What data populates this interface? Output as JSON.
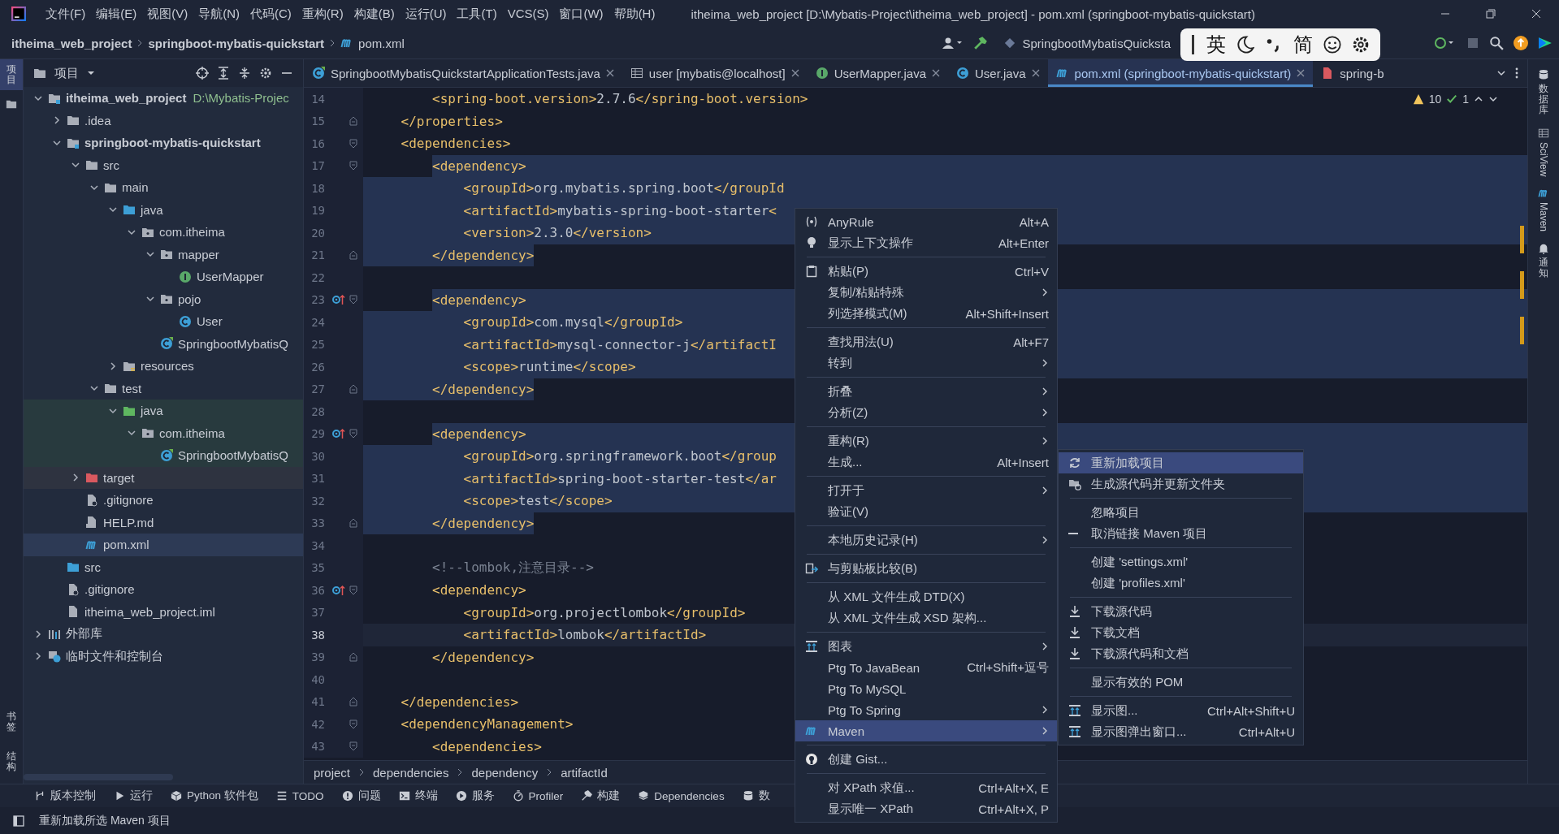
{
  "menu_bar": [
    "文件(F)",
    "编辑(E)",
    "视图(V)",
    "导航(N)",
    "代码(C)",
    "重构(R)",
    "构建(B)",
    "运行(U)",
    "工具(T)",
    "VCS(S)",
    "窗口(W)",
    "帮助(H)"
  ],
  "window": {
    "title": "itheima_web_project [D:\\Mybatis-Project\\itheima_web_project] - pom.xml (springboot-mybatis-quickstart)"
  },
  "nav_bar": {
    "breadcrumb": [
      {
        "label": "itheima_web_project",
        "kind": "project"
      },
      {
        "label": "springboot-mybatis-quickstart",
        "kind": "module"
      },
      {
        "label": "pom.xml",
        "kind": "maven-file"
      }
    ],
    "run_config": "SpringbootMybatisQuicksta"
  },
  "ime_toolbar": {
    "items": [
      {
        "kind": "cursor"
      },
      {
        "kind": "text",
        "label": "英"
      },
      {
        "kind": "moon"
      },
      {
        "kind": "punct"
      },
      {
        "kind": "text",
        "label": "简"
      },
      {
        "kind": "emoji"
      },
      {
        "kind": "settings"
      }
    ]
  },
  "left_stripe": {
    "top": [
      {
        "label": "项目",
        "selected": true
      }
    ],
    "bottom": [
      {
        "label": "书签",
        "selected": false
      },
      {
        "label": "结构",
        "selected": false
      }
    ]
  },
  "right_stripe": [
    {
      "label": "数据库",
      "kind": "database"
    },
    {
      "label": "SciView",
      "kind": "sciview"
    },
    {
      "label": "Maven",
      "kind": "maven"
    },
    {
      "label": "通知",
      "kind": "bell"
    }
  ],
  "project_panel": {
    "title": "项目",
    "tree": [
      {
        "label": "itheima_web_project",
        "kind": "module",
        "path": "D:\\Mybatis-Projec",
        "selected": false,
        "expanded": true,
        "children": [
          {
            "label": ".idea",
            "kind": "folder",
            "selected": false,
            "expanded": false
          },
          {
            "label": "springboot-mybatis-quickstart",
            "kind": "module",
            "selected": false,
            "expanded": true,
            "children": [
              {
                "label": "src",
                "kind": "folder",
                "selected": false,
                "expanded": true,
                "children": [
                  {
                    "label": "main",
                    "kind": "folder",
                    "selected": false,
                    "expanded": true,
                    "children": [
                      {
                        "label": "java",
                        "kind": "source-root",
                        "selected": false,
                        "expanded": true,
                        "children": [
                          {
                            "label": "com.itheima",
                            "kind": "package",
                            "selected": false,
                            "expanded": true,
                            "children": [
                              {
                                "label": "mapper",
                                "kind": "package",
                                "selected": false,
                                "expanded": true,
                                "children": [
                                  {
                                    "label": "UserMapper",
                                    "kind": "interface",
                                    "selected": false
                                  }
                                ]
                              },
                              {
                                "label": "pojo",
                                "kind": "package",
                                "selected": false,
                                "expanded": true,
                                "children": [
                                  {
                                    "label": "User",
                                    "kind": "class",
                                    "selected": false
                                  }
                                ]
                              },
                              {
                                "label": "SpringbootMybatisQ",
                                "kind": "spring-class",
                                "selected": false
                              }
                            ]
                          }
                        ]
                      },
                      {
                        "label": "resources",
                        "kind": "resources-root",
                        "selected": false,
                        "expanded": false
                      }
                    ]
                  },
                  {
                    "label": "test",
                    "kind": "folder",
                    "selected": false,
                    "expanded": true,
                    "children": [
                      {
                        "label": "java",
                        "kind": "test-root",
                        "selected": false,
                        "expanded": true,
                        "children": [
                          {
                            "label": "com.itheima",
                            "kind": "package",
                            "selected": false,
                            "expanded": true,
                            "children": [
                              {
                                "label": "SpringbootMybatisQ",
                                "kind": "spring-class",
                                "selected": false
                              }
                            ]
                          }
                        ]
                      }
                    ]
                  }
                ]
              },
              {
                "label": "target",
                "kind": "excluded-folder",
                "selected": false,
                "expanded": false
              },
              {
                "label": ".gitignore",
                "kind": "ignore-file",
                "selected": false
              },
              {
                "label": "HELP.md",
                "kind": "markdown-file",
                "selected": false
              },
              {
                "label": "pom.xml",
                "kind": "maven-file",
                "selected": true
              }
            ]
          },
          {
            "label": "src",
            "kind": "source-root",
            "selected": false
          },
          {
            "label": ".gitignore",
            "kind": "ignore-file",
            "selected": false
          },
          {
            "label": "itheima_web_project.iml",
            "kind": "iml-file",
            "selected": false
          }
        ]
      },
      {
        "label": "外部库",
        "kind": "library",
        "selected": false,
        "expanded": false
      },
      {
        "label": "临时文件和控制台",
        "kind": "scratch",
        "selected": false,
        "expanded": false
      }
    ]
  },
  "editor": {
    "tabs": [
      {
        "label": "SpringbootMybatisQuickstartApplicationTests.java",
        "kind": "spring-class",
        "selected": false,
        "closable": true
      },
      {
        "label": "user [mybatis@localhost]",
        "kind": "db-table",
        "selected": false,
        "closable": true
      },
      {
        "label": "UserMapper.java",
        "kind": "interface",
        "selected": false,
        "closable": true
      },
      {
        "label": "User.java",
        "kind": "class",
        "selected": false,
        "closable": true
      },
      {
        "label": "pom.xml (springboot-mybatis-quickstart)",
        "kind": "maven-file",
        "selected": true,
        "closable": true
      },
      {
        "label": "spring-b",
        "kind": "xml-file",
        "selected": false,
        "closable": false
      }
    ],
    "inspection": {
      "warnings": "10",
      "passed": "1"
    },
    "lines": [
      {
        "number": "14",
        "text": "        <spring-boot.version>2.7.6</spring-boot.version>",
        "kind": "plain",
        "selected": false,
        "current": false,
        "marker": false
      },
      {
        "number": "15",
        "text": "    </properties>",
        "kind": "fold-end",
        "selected": false,
        "current": false,
        "marker": false
      },
      {
        "number": "16",
        "text": "    <dependencies>",
        "kind": "fold-start",
        "selected": false,
        "current": false,
        "marker": false
      },
      {
        "number": "17",
        "text": "        <dependency>",
        "kind": "fold-start",
        "selected": true,
        "current": false,
        "marker": false
      },
      {
        "number": "18",
        "text": "            <groupId>org.mybatis.spring.boot</groupId",
        "kind": "plain",
        "selected": true,
        "current": false,
        "marker": false
      },
      {
        "number": "19",
        "text": "            <artifactId>mybatis-spring-boot-starter<",
        "kind": "plain",
        "selected": true,
        "current": false,
        "marker": false
      },
      {
        "number": "20",
        "text": "            <version>2.3.0</version>",
        "kind": "plain",
        "selected": true,
        "current": false,
        "marker": false
      },
      {
        "number": "21",
        "text": "        </dependency>",
        "kind": "fold-end",
        "selected": true,
        "current": false,
        "marker": false
      },
      {
        "number": "22",
        "kind": "plain",
        "selected": false,
        "current": false,
        "marker": false
      },
      {
        "number": "23",
        "text": "        <dependency>",
        "kind": "fold-start",
        "selected": true,
        "current": false,
        "marker": true
      },
      {
        "number": "24",
        "text": "            <groupId>com.mysql</groupId>",
        "kind": "plain",
        "selected": true,
        "current": false,
        "marker": false
      },
      {
        "number": "25",
        "text": "            <artifactId>mysql-connector-j</artifactI",
        "kind": "plain",
        "selected": true,
        "current": false,
        "marker": false
      },
      {
        "number": "26",
        "text": "            <scope>runtime</scope>",
        "kind": "plain",
        "selected": true,
        "current": false,
        "marker": false
      },
      {
        "number": "27",
        "text": "        </dependency>",
        "kind": "fold-end",
        "selected": true,
        "current": false,
        "marker": false
      },
      {
        "number": "28",
        "kind": "plain",
        "selected": false,
        "current": false,
        "marker": false
      },
      {
        "number": "29",
        "text": "        <dependency>",
        "kind": "fold-start",
        "selected": true,
        "current": false,
        "marker": true
      },
      {
        "number": "30",
        "text": "            <groupId>org.springframework.boot</group",
        "kind": "plain",
        "selected": true,
        "current": false,
        "marker": false
      },
      {
        "number": "31",
        "text": "            <artifactId>spring-boot-starter-test</ar",
        "kind": "plain",
        "selected": true,
        "current": false,
        "marker": false
      },
      {
        "number": "32",
        "text": "            <scope>test</scope>",
        "kind": "plain",
        "selected": true,
        "current": false,
        "marker": false
      },
      {
        "number": "33",
        "text": "        </dependency>",
        "kind": "fold-end",
        "selected": true,
        "current": false,
        "marker": false
      },
      {
        "number": "34",
        "kind": "plain",
        "selected": false,
        "current": false,
        "marker": false
      },
      {
        "number": "35",
        "text": "        <!--lombok,注意目录-->",
        "kind": "comment",
        "selected": false,
        "current": false,
        "marker": false
      },
      {
        "number": "36",
        "text": "        <dependency>",
        "kind": "fold-start",
        "selected": false,
        "current": false,
        "marker": true
      },
      {
        "number": "37",
        "text": "            <groupId>org.projectlombok</groupId>",
        "kind": "plain",
        "selected": false,
        "current": false,
        "marker": false
      },
      {
        "number": "38",
        "text": "            <artifactId>lombok</artifactId>",
        "kind": "plain",
        "selected": false,
        "current": true,
        "marker": false
      },
      {
        "number": "39",
        "text": "        </dependency>",
        "kind": "fold-end",
        "selected": false,
        "current": false,
        "marker": false
      },
      {
        "number": "40",
        "kind": "plain",
        "selected": false,
        "current": false,
        "marker": false
      },
      {
        "number": "41",
        "text": "    </dependencies>",
        "kind": "fold-end",
        "selected": false,
        "current": false,
        "marker": false
      },
      {
        "number": "42",
        "text": "    <dependencyManagement>",
        "kind": "fold-start",
        "selected": false,
        "current": false,
        "marker": false
      },
      {
        "number": "43",
        "text": "        <dependencies>",
        "kind": "fold-start",
        "selected": false,
        "current": false,
        "marker": false
      }
    ],
    "breadcrumb": [
      "project",
      "dependencies",
      "dependency",
      "artifactId"
    ]
  },
  "context_menu": {
    "items": [
      {
        "kind": "regex",
        "label": "AnyRule",
        "shortcut": "Alt+A",
        "submenu": false,
        "selected": false
      },
      {
        "kind": "bulb",
        "label": "显示上下文操作",
        "shortcut": "Alt+Enter",
        "submenu": false,
        "selected": false
      },
      {
        "kind": "separator"
      },
      {
        "kind": "clipboard",
        "label": "粘贴(P)",
        "shortcut": "Ctrl+V",
        "submenu": false,
        "selected": false
      },
      {
        "kind": "plain",
        "label": "复制/粘贴特殊",
        "submenu": true,
        "selected": false
      },
      {
        "kind": "plain",
        "label": "列选择模式(M)",
        "shortcut": "Alt+Shift+Insert",
        "submenu": false,
        "selected": false
      },
      {
        "kind": "separator"
      },
      {
        "kind": "plain",
        "label": "查找用法(U)",
        "shortcut": "Alt+F7",
        "submenu": false,
        "selected": false
      },
      {
        "kind": "plain",
        "label": "转到",
        "submenu": true,
        "selected": false
      },
      {
        "kind": "separator"
      },
      {
        "kind": "plain",
        "label": "折叠",
        "submenu": true,
        "selected": false
      },
      {
        "kind": "plain",
        "label": "分析(Z)",
        "submenu": true,
        "selected": false
      },
      {
        "kind": "separator"
      },
      {
        "kind": "plain",
        "label": "重构(R)",
        "submenu": true,
        "selected": false
      },
      {
        "kind": "plain",
        "label": "生成...",
        "shortcut": "Alt+Insert",
        "submenu": false,
        "selected": false
      },
      {
        "kind": "separator"
      },
      {
        "kind": "plain",
        "label": "打开于",
        "submenu": true,
        "selected": false
      },
      {
        "kind": "plain",
        "label": "验证(V)",
        "submenu": false,
        "selected": false
      },
      {
        "kind": "separator"
      },
      {
        "kind": "plain",
        "label": "本地历史记录(H)",
        "submenu": true,
        "selected": false
      },
      {
        "kind": "separator"
      },
      {
        "kind": "compare",
        "label": "与剪贴板比较(B)",
        "submenu": false,
        "selected": false
      },
      {
        "kind": "separator"
      },
      {
        "kind": "plain",
        "label": "从 XML 文件生成 DTD(X)",
        "submenu": false,
        "selected": false
      },
      {
        "kind": "plain",
        "label": "从 XML 文件生成 XSD 架构...",
        "submenu": false,
        "selected": false
      },
      {
        "kind": "separator"
      },
      {
        "kind": "diagram",
        "label": "图表",
        "submenu": true,
        "selected": false
      },
      {
        "kind": "plain",
        "label": "Ptg To JavaBean",
        "shortcut": "Ctrl+Shift+逗号",
        "submenu": false,
        "selected": false
      },
      {
        "kind": "plain",
        "label": "Ptg To MySQL",
        "submenu": false,
        "selected": false
      },
      {
        "kind": "plain",
        "label": "Ptg To Spring",
        "submenu": true,
        "selected": false
      },
      {
        "kind": "maven",
        "label": "Maven",
        "submenu": true,
        "selected": true
      },
      {
        "kind": "separator"
      },
      {
        "kind": "github",
        "label": "创建 Gist...",
        "submenu": false,
        "selected": false
      },
      {
        "kind": "separator"
      },
      {
        "kind": "plain",
        "label": "对 XPath 求值...",
        "shortcut": "Ctrl+Alt+X, E",
        "submenu": false,
        "selected": false
      },
      {
        "kind": "plain",
        "label": "显示唯一 XPath",
        "shortcut": "Ctrl+Alt+X, P",
        "submenu": false,
        "selected": false
      }
    ]
  },
  "submenu": {
    "items": [
      {
        "kind": "reload",
        "label": "重新加载项目",
        "selected": true
      },
      {
        "kind": "folder-sync",
        "label": "生成源代码并更新文件夹",
        "selected": false
      },
      {
        "kind": "separator"
      },
      {
        "kind": "plain",
        "label": "忽略项目",
        "selected": false
      },
      {
        "kind": "minus",
        "label": "取消链接 Maven 项目",
        "selected": false
      },
      {
        "kind": "separator"
      },
      {
        "kind": "plain",
        "label": "创建 'settings.xml'",
        "selected": false
      },
      {
        "kind": "plain",
        "label": "创建 'profiles.xml'",
        "selected": false
      },
      {
        "kind": "separator"
      },
      {
        "kind": "download",
        "label": "下载源代码",
        "selected": false
      },
      {
        "kind": "download",
        "label": "下载文档",
        "selected": false
      },
      {
        "kind": "download",
        "label": "下载源代码和文档",
        "selected": false
      },
      {
        "kind": "separator"
      },
      {
        "kind": "plain",
        "label": "显示有效的 POM",
        "selected": false
      },
      {
        "kind": "separator"
      },
      {
        "kind": "diagram",
        "label": "显示图...",
        "shortcut": "Ctrl+Alt+Shift+U",
        "selected": false
      },
      {
        "kind": "diagram",
        "label": "显示图弹出窗口...",
        "shortcut": "Ctrl+Alt+U",
        "selected": false
      }
    ]
  },
  "tool_bar": [
    {
      "label": "版本控制",
      "kind": "vcs"
    },
    {
      "label": "运行",
      "kind": "run"
    },
    {
      "label": "Python 软件包",
      "kind": "python"
    },
    {
      "label": "TODO",
      "kind": "todo"
    },
    {
      "label": "问题",
      "kind": "problems"
    },
    {
      "label": "终端",
      "kind": "terminal"
    },
    {
      "label": "服务",
      "kind": "services"
    },
    {
      "label": "Profiler",
      "kind": "profiler"
    },
    {
      "label": "构建",
      "kind": "build"
    },
    {
      "label": "Dependencies",
      "kind": "dependencies"
    },
    {
      "label": "数",
      "kind": "database"
    }
  ],
  "status_bar": {
    "message": "重新加载所选 Maven 项目"
  }
}
